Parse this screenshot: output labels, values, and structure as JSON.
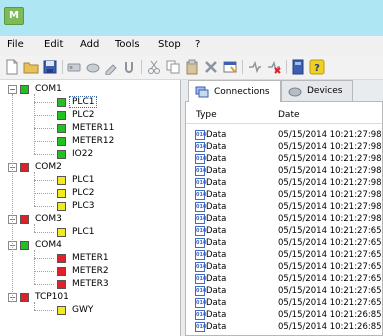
{
  "app": {
    "icon_text": "M",
    "icon": "app-logo-icon"
  },
  "menu": [
    "File",
    "Edit",
    "Add",
    "Tools",
    "Stop",
    "?"
  ],
  "toolbar": [
    "new-icon",
    "open-icon",
    "save-icon",
    "connect-icon",
    "disconnect-icon",
    "settings-icon",
    "paste-icon",
    "cut-icon",
    "copy-icon",
    "paste2-icon",
    "delete-icon",
    "properties-icon",
    "run-icon",
    "stop-icon",
    "device-icon",
    "help-icon"
  ],
  "tree": [
    {
      "label": "COM1",
      "level": 0,
      "status": "green",
      "expanded": true
    },
    {
      "label": "PLC1",
      "level": 1,
      "status": "green",
      "selected": true
    },
    {
      "label": "PLC2",
      "level": 1,
      "status": "green"
    },
    {
      "label": "METER11",
      "level": 1,
      "status": "green"
    },
    {
      "label": "METER12",
      "level": 1,
      "status": "green"
    },
    {
      "label": "IO22",
      "level": 1,
      "status": "green"
    },
    {
      "label": "COM2",
      "level": 0,
      "status": "red",
      "expanded": true
    },
    {
      "label": "PLC1",
      "level": 1,
      "status": "yellow"
    },
    {
      "label": "PLC2",
      "level": 1,
      "status": "yellow"
    },
    {
      "label": "PLC3",
      "level": 1,
      "status": "yellow"
    },
    {
      "label": "COM3",
      "level": 0,
      "status": "red",
      "expanded": true
    },
    {
      "label": "PLC1",
      "level": 1,
      "status": "yellow"
    },
    {
      "label": "COM4",
      "level": 0,
      "status": "green",
      "expanded": true
    },
    {
      "label": "METER1",
      "level": 1,
      "status": "red"
    },
    {
      "label": "METER2",
      "level": 1,
      "status": "red"
    },
    {
      "label": "METER3",
      "level": 1,
      "status": "red"
    },
    {
      "label": "TCP101",
      "level": 0,
      "status": "red",
      "expanded": true
    },
    {
      "label": "GWY",
      "level": 1,
      "status": "yellow"
    }
  ],
  "tabs": [
    {
      "label": "Connections",
      "icon": "connections-icon",
      "active": true
    },
    {
      "label": "Devices",
      "icon": "devices-icon",
      "active": false
    }
  ],
  "log": {
    "columns": [
      "Type",
      "Date"
    ],
    "row_icon": "data-icon",
    "rows": [
      [
        "Data",
        "05/15/2014 10:21:27:98"
      ],
      [
        "Data",
        "05/15/2014 10:21:27:98"
      ],
      [
        "Data",
        "05/15/2014 10:21:27:98"
      ],
      [
        "Data",
        "05/15/2014 10:21:27:98"
      ],
      [
        "Data",
        "05/15/2014 10:21:27:98"
      ],
      [
        "Data",
        "05/15/2014 10:21:27:98"
      ],
      [
        "Data",
        "05/15/2014 10:21:27:98"
      ],
      [
        "Data",
        "05/15/2014 10:21:27:98"
      ],
      [
        "Data",
        "05/15/2014 10:21:27:65"
      ],
      [
        "Data",
        "05/15/2014 10:21:27:65"
      ],
      [
        "Data",
        "05/15/2014 10:21:27:65"
      ],
      [
        "Data",
        "05/15/2014 10:21:27:65"
      ],
      [
        "Data",
        "05/15/2014 10:21:27:65"
      ],
      [
        "Data",
        "05/15/2014 10:21:27:65"
      ],
      [
        "Data",
        "05/15/2014 10:21:27:65"
      ],
      [
        "Data",
        "05/15/2014 10:21:26:85"
      ],
      [
        "Data",
        "05/15/2014 10:21:26:85"
      ]
    ]
  },
  "colors": {
    "titlebar": "#aee6f4",
    "green": "#22c022",
    "red": "#e0202a",
    "yellow": "#f2ea1c",
    "accent": "#4169c8"
  }
}
